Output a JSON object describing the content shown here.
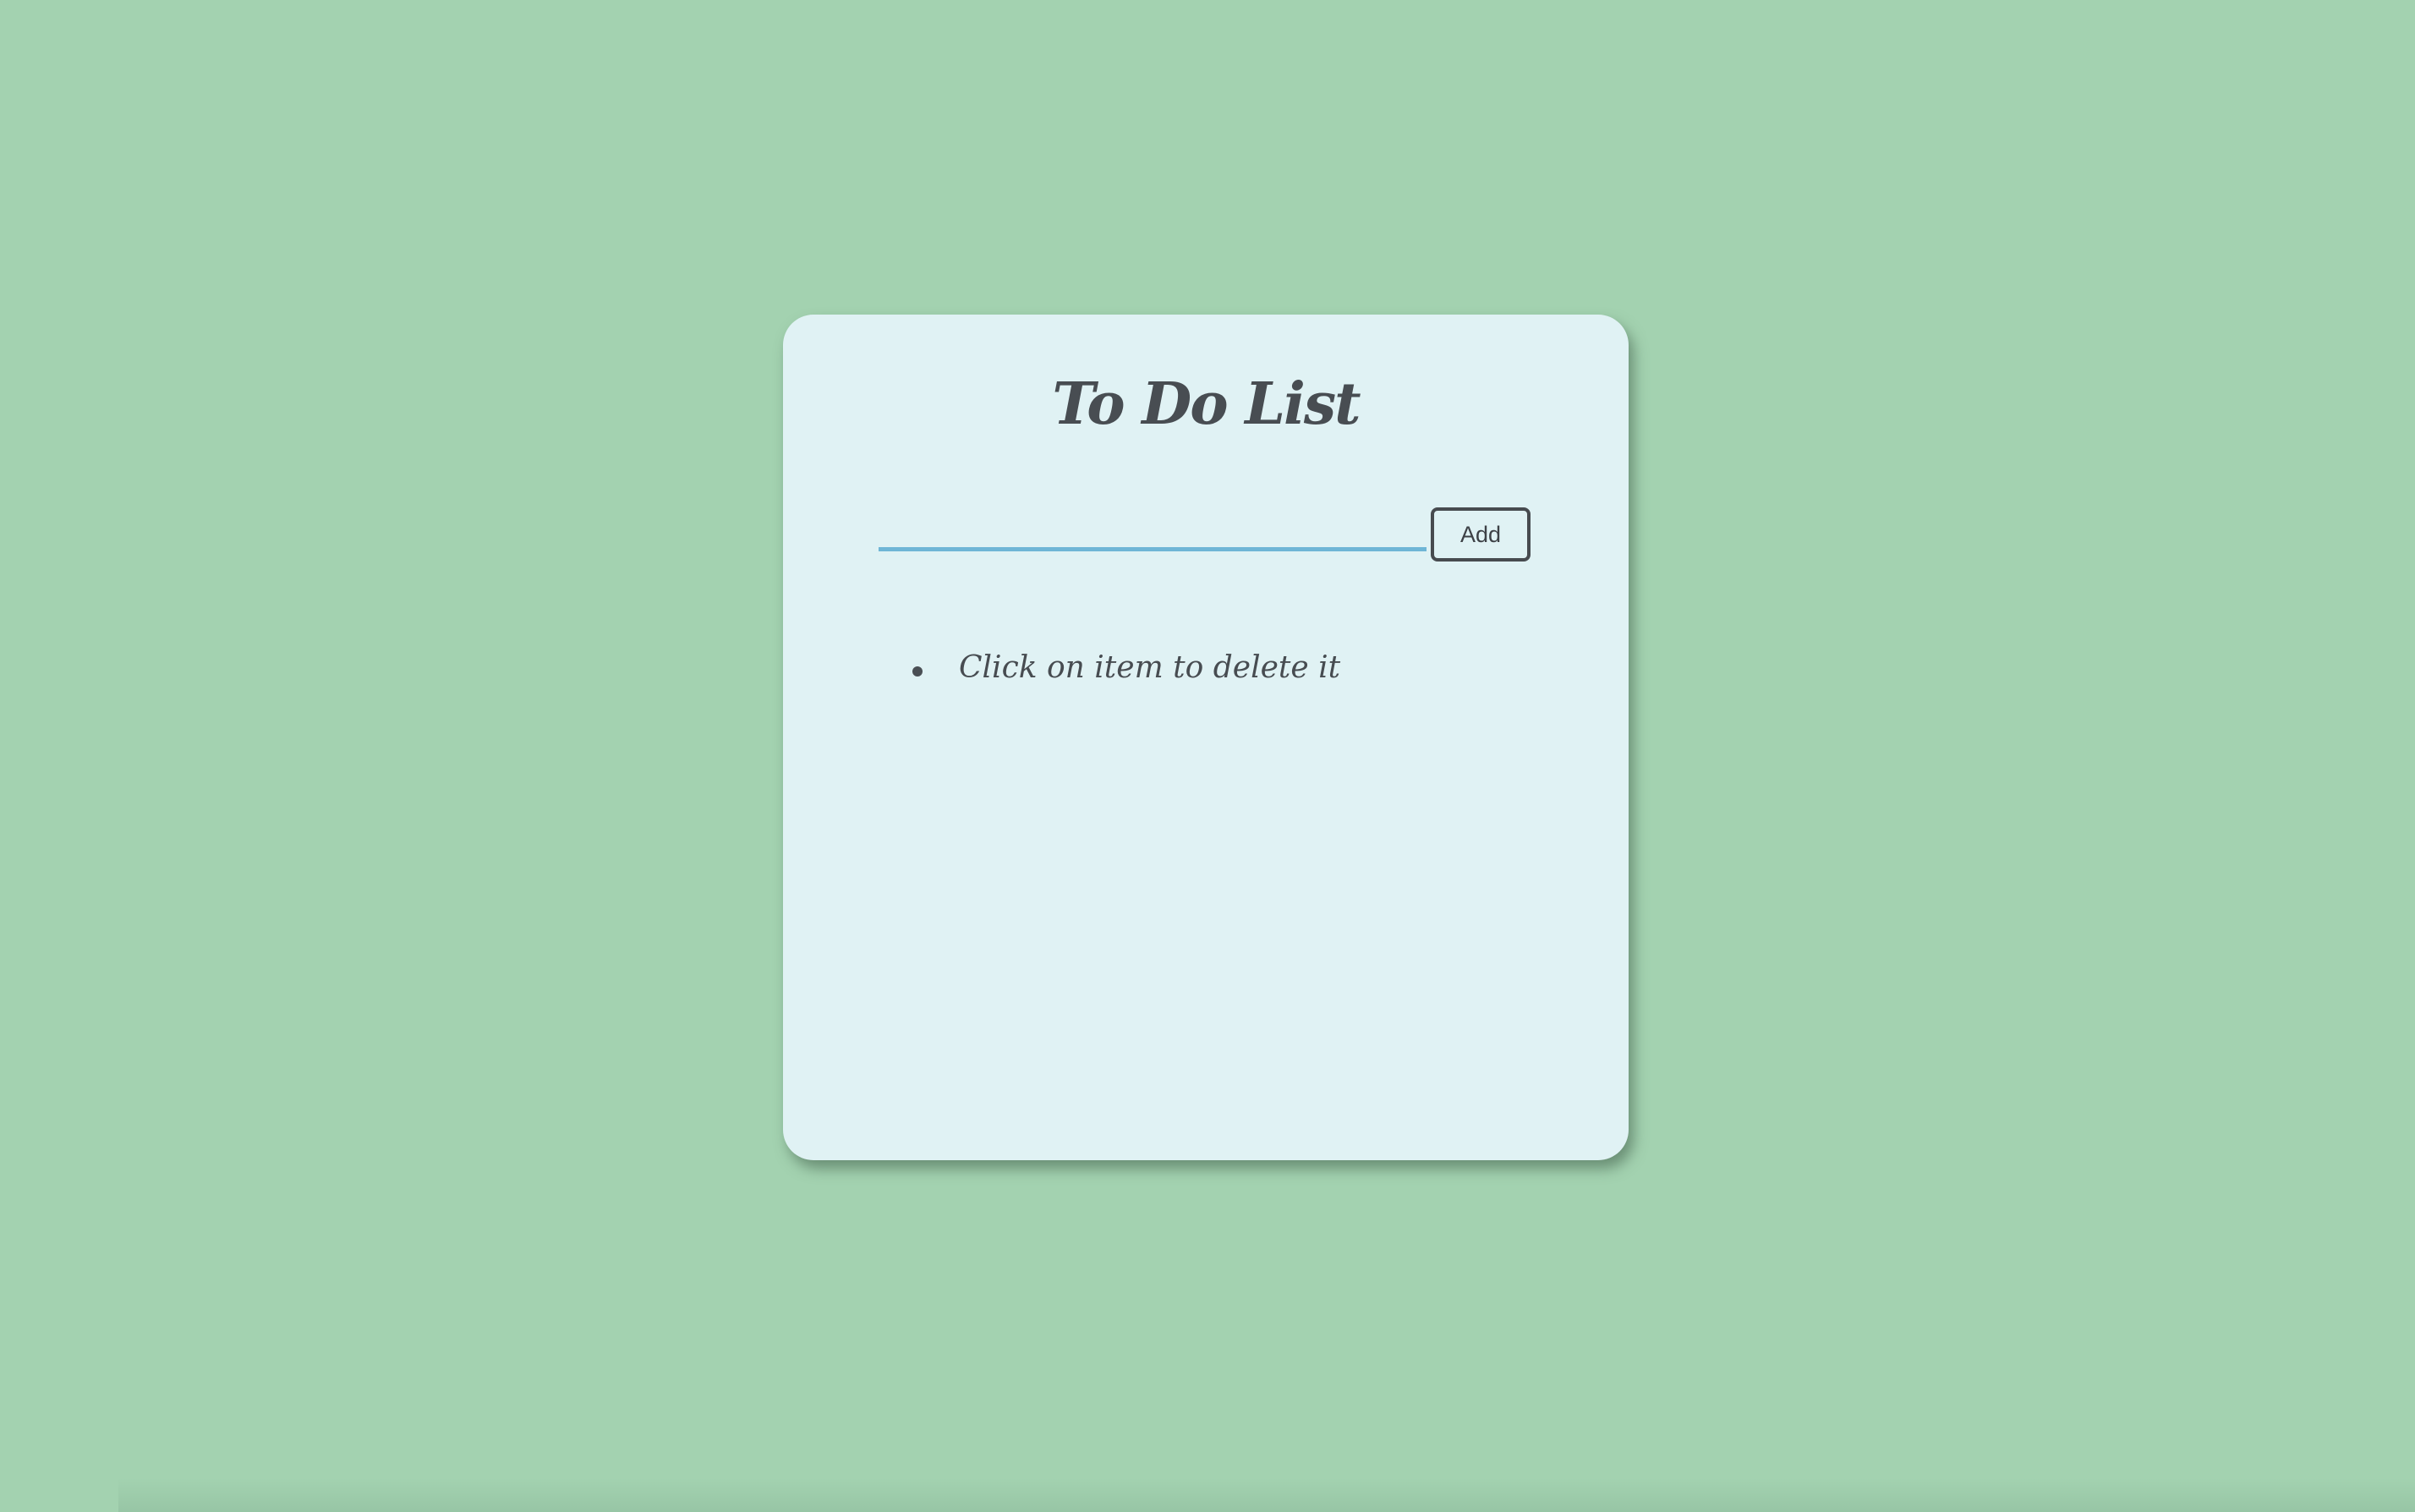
{
  "app": {
    "title": "To Do List"
  },
  "form": {
    "input_value": "",
    "input_placeholder": "",
    "add_label": "Add"
  },
  "items": [
    {
      "text": "Click on item to delete it"
    }
  ],
  "colors": {
    "background": "#a3d2b0",
    "card": "#e0f2f4",
    "input_underline": "#6fb6d6",
    "text": "#474c51"
  }
}
